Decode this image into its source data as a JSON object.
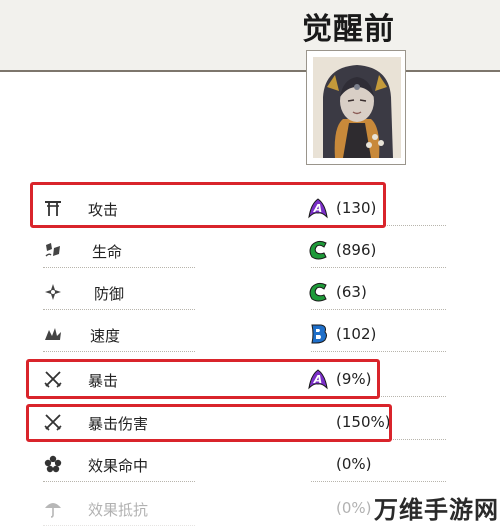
{
  "header": {
    "title": "觉醒前"
  },
  "stats": [
    {
      "icon": "torii-gate-icon",
      "name": "攻击",
      "rank": "A",
      "rank_color": "#7a2fc7",
      "value": "(130)"
    },
    {
      "icon": "heart-life-icon",
      "name": "生命",
      "rank": "C",
      "rank_color": "#1e9a39",
      "value": "(896)"
    },
    {
      "icon": "shield-defense-icon",
      "name": "防御",
      "rank": "C",
      "rank_color": "#1e9a39",
      "value": "(63)"
    },
    {
      "icon": "speed-wings-icon",
      "name": "速度",
      "rank": "B",
      "rank_color": "#1f6fc9",
      "value": "(102)"
    },
    {
      "icon": "crossed-swords-icon",
      "name": "暴击",
      "rank": "A",
      "rank_color": "#7a2fc7",
      "value": "(9%)"
    },
    {
      "icon": "crossed-swords-icon",
      "name": "暴击伤害",
      "rank": "",
      "rank_color": "",
      "value": "(150%)"
    },
    {
      "icon": "flower-effect-icon",
      "name": "效果命中",
      "rank": "",
      "rank_color": "",
      "value": "(0%)"
    },
    {
      "icon": "umbrella-resist-icon",
      "name": "效果抵抗",
      "rank": "",
      "rank_color": "",
      "value": "(0%)"
    }
  ],
  "highlight_color": "#d9242b",
  "watermark": "万维手游网"
}
